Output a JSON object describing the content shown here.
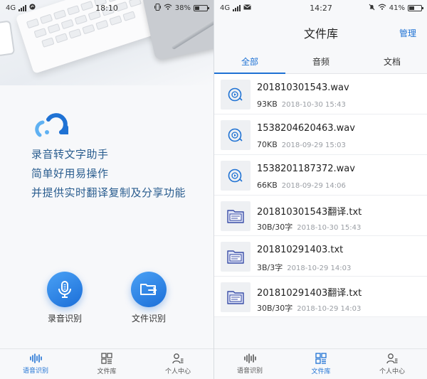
{
  "left": {
    "status": {
      "network": "4G",
      "time": "18:10",
      "battery": "38%",
      "battery_level": 0.38
    },
    "slogans": [
      "录音转文字助手",
      "简单好用易操作",
      "并提供实时翻译复制及分享功能"
    ],
    "actions": [
      {
        "icon": "microphone-icon",
        "label": "录音识别"
      },
      {
        "icon": "folder-export-icon",
        "label": "文件识别"
      }
    ],
    "nav": [
      {
        "icon": "waveform-icon",
        "label": "语音识别",
        "active": true
      },
      {
        "icon": "grid-icon",
        "label": "文件库",
        "active": false
      },
      {
        "icon": "user-icon",
        "label": "个人中心",
        "active": false
      }
    ]
  },
  "right": {
    "status": {
      "network": "4G",
      "time": "14:27",
      "battery": "41%",
      "battery_level": 0.41
    },
    "header": {
      "title": "文件库",
      "manage_label": "管理"
    },
    "tabs": [
      {
        "label": "全部",
        "active": true
      },
      {
        "label": "音频",
        "active": false
      },
      {
        "label": "文档",
        "active": false
      }
    ],
    "files": [
      {
        "name": "201810301543.wav",
        "size": "93KB",
        "date": "2018-10-30 15:43",
        "kind": "audio"
      },
      {
        "name": "1538204620463.wav",
        "size": "70KB",
        "date": "2018-09-29 15:03",
        "kind": "audio"
      },
      {
        "name": "1538201187372.wav",
        "size": "66KB",
        "date": "2018-09-29 14:06",
        "kind": "audio"
      },
      {
        "name": "201810301543翻译.txt",
        "size": "30B/30字",
        "date": "2018-10-30 15:43",
        "kind": "text"
      },
      {
        "name": "201810291403.txt",
        "size": "3B/3字",
        "date": "2018-10-29 14:03",
        "kind": "text"
      },
      {
        "name": "201810291403翻译.txt",
        "size": "30B/30字",
        "date": "2018-10-29 14:03",
        "kind": "text"
      }
    ],
    "nav": [
      {
        "icon": "waveform-icon",
        "label": "语音识别",
        "active": false
      },
      {
        "icon": "grid-icon",
        "label": "文件库",
        "active": true
      },
      {
        "icon": "user-icon",
        "label": "个人中心",
        "active": false
      }
    ]
  },
  "colors": {
    "accent": "#1f72d4",
    "slogan": "#2a5d8f",
    "muted": "#9a9ea4"
  }
}
